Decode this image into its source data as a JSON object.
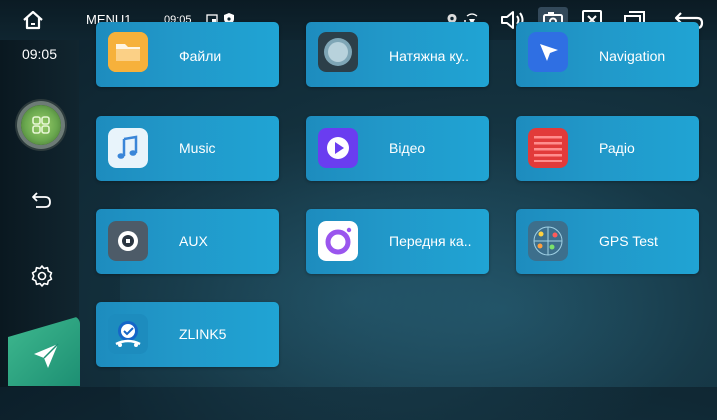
{
  "statusbar": {
    "menu_label": "MENU1",
    "time": "09:05"
  },
  "sidebar": {
    "time": "09:05"
  },
  "apps": [
    {
      "label": "Файли",
      "icon": "folder-icon"
    },
    {
      "label": "Натяжна ку..",
      "icon": "floating-ball-icon"
    },
    {
      "label": "Navigation",
      "icon": "navigation-arrow-icon"
    },
    {
      "label": "Music",
      "icon": "music-note-icon"
    },
    {
      "label": "Відео",
      "icon": "video-play-icon"
    },
    {
      "label": "Радіо",
      "icon": "radio-icon"
    },
    {
      "label": "AUX",
      "icon": "aux-icon"
    },
    {
      "label": "Передня ка..",
      "icon": "front-camera-icon"
    },
    {
      "label": "GPS Test",
      "icon": "gps-test-icon"
    },
    {
      "label": "ZLINK5",
      "icon": "zlink-icon"
    }
  ],
  "colors": {
    "tile": "#2197c8",
    "accent_green": "#3fb98f"
  }
}
